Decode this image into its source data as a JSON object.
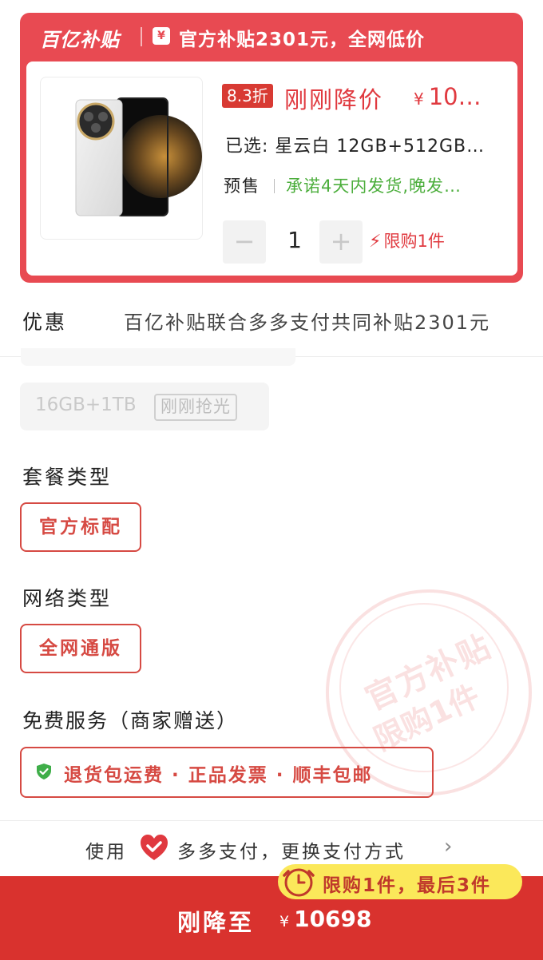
{
  "header": {
    "logo": "百亿补贴",
    "yen_icon": "¥",
    "subsidy_text": "官方补贴2301元，全网低价"
  },
  "product": {
    "discount": "8.3折",
    "drop_label": "刚刚降价",
    "price_symbol": "¥",
    "price": "10…",
    "selected": "已选: 星云白 12GB+512GB…",
    "presale_label": "预售",
    "promise": "承诺4天内发货,晚发…",
    "quantity": "1",
    "minus": "−",
    "plus": "+",
    "limit": "限购1件",
    "image": "folding-phone-white"
  },
  "offer": {
    "label": "优惠",
    "text": "百亿补贴联合多多支付共同补贴2301元"
  },
  "storage_sold_out": {
    "spec": "16GB+1TB",
    "tag": "刚刚抢光"
  },
  "package": {
    "title": "套餐类型",
    "option": "官方标配"
  },
  "network": {
    "title": "网络类型",
    "option": "全网通版"
  },
  "service": {
    "title": "免费服务（商家赠送）",
    "items": "退货包运费 · 正品发票 · 顺丰包邮"
  },
  "stamp": {
    "line1": "官方补贴",
    "line2": "限购1件"
  },
  "payment": {
    "prefix": "使用",
    "text": "多多支付，更换支付方式",
    "arrow": "›"
  },
  "bottom": {
    "badge": "限购1件，最后3件",
    "label": "刚降至",
    "price_symbol": "¥",
    "price": "10698"
  },
  "colors": {
    "brand_red": "#e84a52",
    "button_red": "#d9322e",
    "green": "#4cae3c",
    "badge_yellow": "#fbe85a"
  }
}
